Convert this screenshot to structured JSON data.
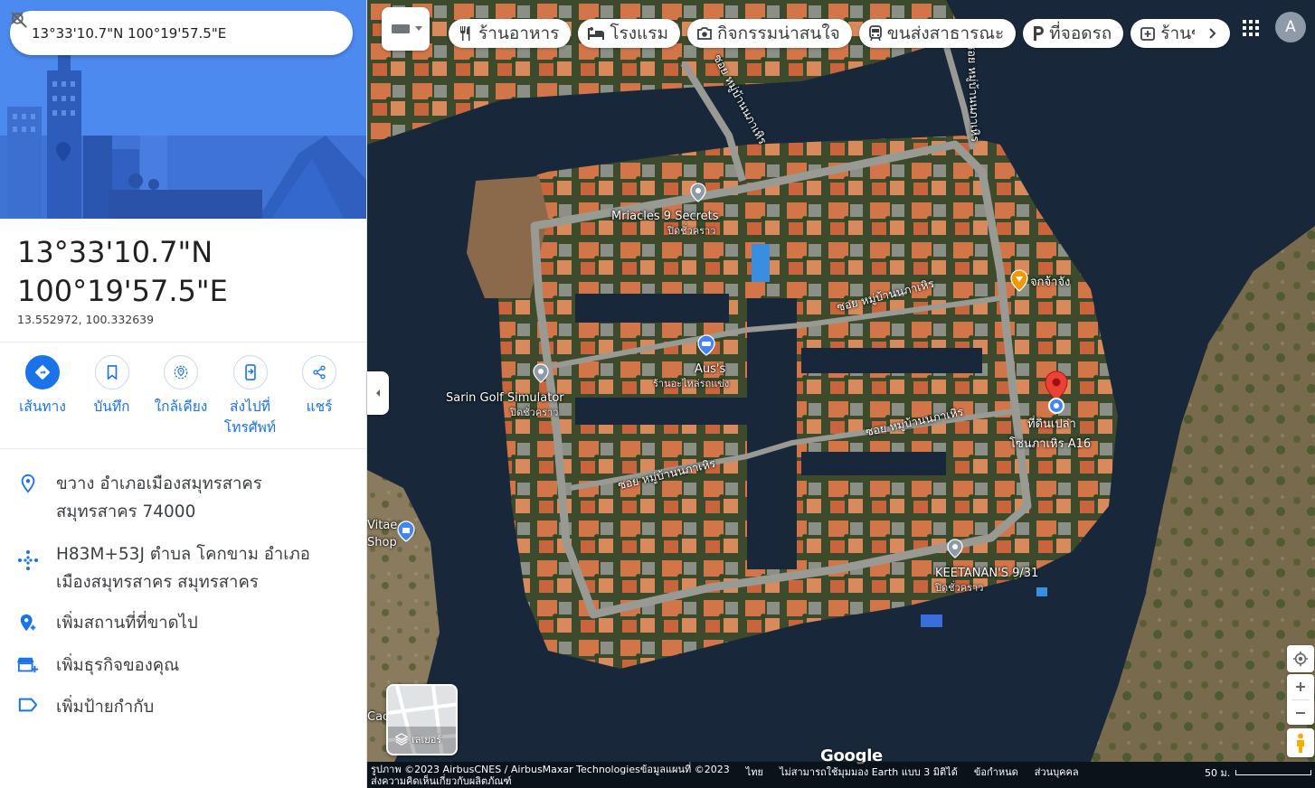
{
  "search": {
    "query": "13°33'10.7\"N 100°19'57.5\"E"
  },
  "place": {
    "title_line1": "13°33'10.7\"N",
    "title_line2": "100°19'57.5\"E",
    "decimal_coords": "13.552972, 100.332639"
  },
  "actions": [
    {
      "label": "เส้นทาง",
      "icon": "directions-icon"
    },
    {
      "label": "บันทึก",
      "icon": "bookmark-icon"
    },
    {
      "label": "ใกล้เคียง",
      "icon": "nearby-icon"
    },
    {
      "label_line1": "ส่งไปที่",
      "label_line2": "โทรศัพท์",
      "icon": "send-to-phone-icon"
    },
    {
      "label": "แชร์",
      "icon": "share-icon"
    }
  ],
  "info": {
    "address_line1": "ขวาง อำเภอเมืองสมุทรสาคร",
    "address_line2": "สมุทรสาคร 74000",
    "pluscode_line1": "H83M+53J ตำบล โคกขาม อำเภอ",
    "pluscode_line2": "เมืองสมุทรสาคร สมุทรสาคร",
    "add_place": "เพิ่มสถานที่ที่ขาดไป",
    "add_business": "เพิ่มธุรกิจของคุณ",
    "add_label": "เพิ่มป้ายกำกับ"
  },
  "chips": [
    {
      "label": "ร้านอาหาร",
      "icon": "restaurant-icon"
    },
    {
      "label": "โรงแรม",
      "icon": "hotel-icon"
    },
    {
      "label": "กิจกรรมน่าสนใจ",
      "icon": "camera-icon"
    },
    {
      "label": "ขนส่งสาธารณะ",
      "icon": "transit-icon"
    },
    {
      "label": "ที่จอดรถ",
      "icon": "parking-icon"
    },
    {
      "label": "ร้านข",
      "icon": "pharmacy-icon"
    }
  ],
  "account": {
    "initial": "A"
  },
  "map_labels": {
    "miracles": "Mriacles 9 Secrets",
    "miracles_sub": "ปิดชั่วคราว",
    "aus": "Aus's",
    "aus_sub": "ร้านอะไหล่รถแข่ง",
    "sarin": "Sarin Golf Simulator",
    "sarin_sub": "ปิดชั่วคราว",
    "keetanan": "KEETANAN'S 9/31",
    "keetanan_sub": "ปิดชั่วคราว",
    "jak": "จกจ้าจัง",
    "pin_line1": "ที่ดินเปล่า",
    "pin_line2": "โซนภาเหิร A16",
    "vitae_line1": "Vitae",
    "vitae_line2": "Shop",
    "cac": "Cac",
    "street1": "ซอย หมู่บ้านนภาเหิร",
    "street2": "ซอย หมู่บ้านนภาเหิร",
    "street3": "ซอย หมู่บ้านนภาเหิร",
    "street4": "ซอย หมู่บ้านนภาเหิร",
    "street5": "ซอย หมู่บ้านนภาเหิร"
  },
  "layers_label": "เลเยอร์",
  "google": "Google",
  "footer": {
    "attribution_line1": "รูปภาพ ©2023 AirbusCNES / AirbusMaxar Technologiesข้อมูลแผนที่ ©2023",
    "attribution_line2": "ส่งความคิดเห็นเกี่ยวกับผลิตภัณฑ์",
    "lang": "ไทย",
    "earth3d": "ไม่สามารถใช้มุมมอง Earth แบบ 3 มิติได้",
    "terms": "ข้อกำหนด",
    "privacy": "ส่วนบุคคล",
    "scale": "50 ม."
  },
  "colors": {
    "accent": "#1a73e8",
    "hero": "#4a86e8",
    "water": "#17273a",
    "pin": "#ea4335",
    "poi_orange": "#f29900"
  }
}
